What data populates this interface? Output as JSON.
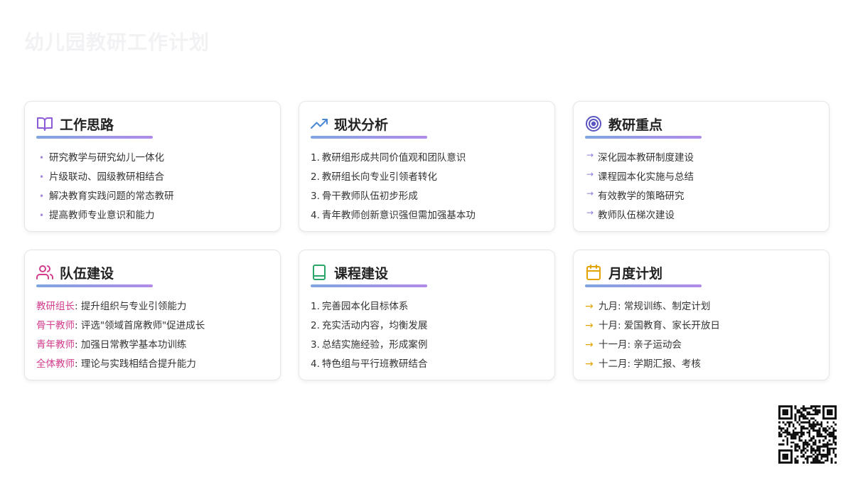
{
  "page": {
    "title": "幼儿园教研工作计划"
  },
  "cards": [
    {
      "title": "工作思路",
      "icon": "open-book-icon",
      "bullet": "•",
      "items": [
        "研究教学与研究幼儿一体化",
        "片级联动、园级教研相结合",
        "解决教育实践问题的常态教研",
        "提高教师专业意识和能力"
      ]
    },
    {
      "title": "现状分析",
      "icon": "trending-up-icon",
      "items": [
        {
          "num": "1.",
          "text": "教研组形成共同价值观和团队意识"
        },
        {
          "num": "2.",
          "text": "教研组长向专业引领者转化"
        },
        {
          "num": "3.",
          "text": "骨干教师队伍初步形成"
        },
        {
          "num": "4.",
          "text": "青年教师创新意识强但需加强基本功"
        }
      ]
    },
    {
      "title": "教研重点",
      "icon": "target-icon",
      "bullet": "→",
      "items": [
        "深化园本教研制度建设",
        "课程园本化实施与总结",
        "有效教学的策略研究",
        "教师队伍梯次建设"
      ]
    },
    {
      "title": "队伍建设",
      "icon": "users-icon",
      "items": [
        {
          "role": "教研组长",
          "text": ": 提升组织与专业引领能力"
        },
        {
          "role": "骨干教师",
          "text": ": 评选\"领域首席教师\"促进成长"
        },
        {
          "role": "青年教师",
          "text": ": 加强日常教学基本功训练"
        },
        {
          "role": "全体教师",
          "text": ": 理论与实践相结合提升能力"
        }
      ]
    },
    {
      "title": "课程建设",
      "icon": "book-icon",
      "items": [
        {
          "num": "1.",
          "text": "完善园本化目标体系"
        },
        {
          "num": "2.",
          "text": "充实活动内容，均衡发展"
        },
        {
          "num": "3.",
          "text": "总结实施经验，形成案例"
        },
        {
          "num": "4.",
          "text": "特色组与平行班教研结合"
        }
      ]
    },
    {
      "title": "月度计划",
      "icon": "calendar-icon",
      "bullet": "→",
      "items": [
        "九月: 常规训练、制定计划",
        "十月: 爱国教育、家长开放日",
        "十一月: 亲子运动会",
        "十二月: 学期汇报、考核"
      ]
    }
  ],
  "colors": {
    "purple": "#8e5bd8",
    "blue": "#4a86d6",
    "indigo": "#5a55c0",
    "pink": "#d23c8c",
    "green": "#2aa66a",
    "amber": "#e2a400"
  },
  "qr": {
    "icon": "qr-code-icon"
  }
}
